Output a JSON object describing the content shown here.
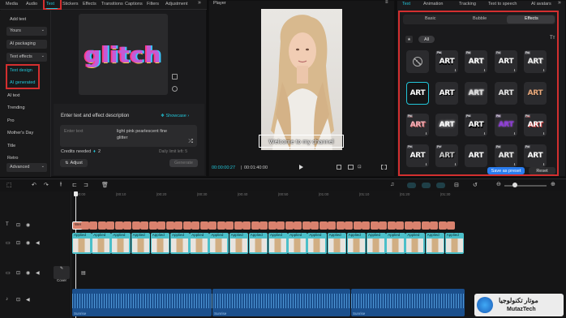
{
  "left_tabs": [
    "Media",
    "Audio",
    "Text",
    "Stickers",
    "Effects",
    "Transitions",
    "Captions",
    "Filters",
    "Adjustment"
  ],
  "sidebar": {
    "add_text": "Add text",
    "yours": "Yours",
    "ai_packaging": "AI packaging",
    "text_effects": "Text effects",
    "text_design": "Text design",
    "ai_generated": "AI generated",
    "ai_text": "AI text",
    "trending": "Trending",
    "pro": "Pro",
    "mothers_day": "Mother's Day",
    "title": "Title",
    "retro": "Retro",
    "advanced": "Advanced"
  },
  "preview": {
    "glitch_text": "glitch"
  },
  "prompt": {
    "heading": "Enter text and effect description",
    "showcase": "Showcase",
    "enter_text_placeholder": "Enter text",
    "description": "light pink pearlescent fine glitter",
    "credits_label": "Credits needed",
    "credits_value": "2",
    "adjust_label": "Adjust",
    "generate_label": "Generate",
    "daily_limit": "Daily limit left: 5"
  },
  "player": {
    "title": "Player",
    "caption": "Welcome to my channel",
    "timecode_current": "00:00:00:27",
    "timecode_total": "00:01:40:00"
  },
  "right_tabs": [
    "Text",
    "Animation",
    "Tracking",
    "Text to speech",
    "AI avatars"
  ],
  "style_tabs": [
    "Basic",
    "Bubble",
    "Effects"
  ],
  "filter_all": "All",
  "tile_label": "ART",
  "save_preset": "Save as preset",
  "reset": "Reset",
  "ruler": [
    "|00:00",
    "|00:10",
    "|00:20",
    "|00:30",
    "|00:40",
    "|00:50",
    "|01:00",
    "|01:10",
    "|01:20",
    "|01:30"
  ],
  "track_text_clip": "Welc",
  "track_video_clip": "Applied",
  "cover_label": "Cover",
  "audio_label": "Sunrise",
  "watermark": {
    "arabic": "موتار تكنولوجيا",
    "latin": "MutazTech"
  },
  "colors": {
    "accent": "#22c5d8",
    "highlight_border": "#d32f2f",
    "text_clip": "#d9826e",
    "video_clip": "#4bbfc9",
    "audio_clip": "#1b4f8c",
    "save_button": "#2a7df0"
  }
}
